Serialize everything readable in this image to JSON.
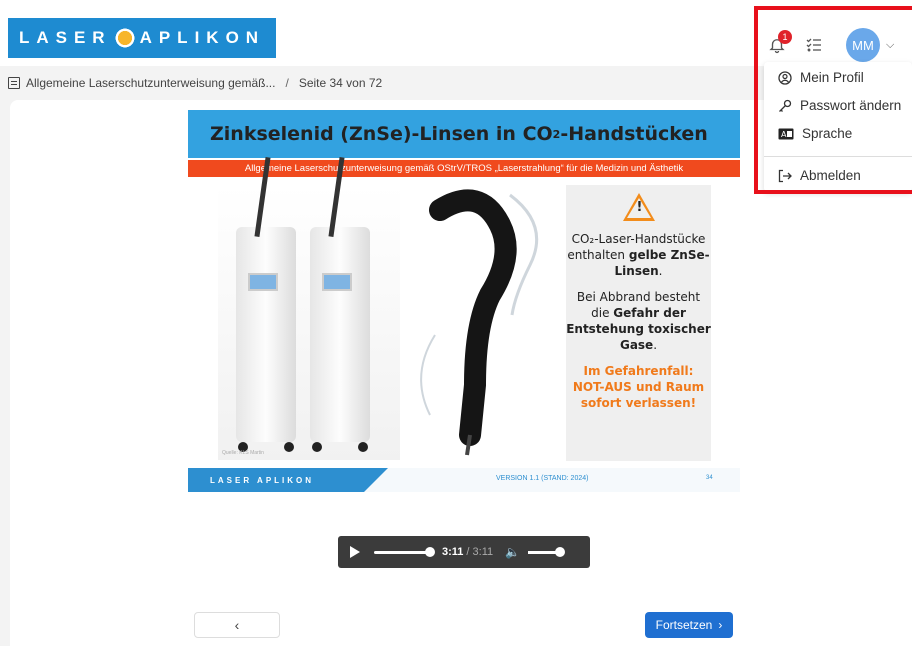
{
  "header": {
    "logo_left": "LASER",
    "logo_right": "APLIKON",
    "notification_count": "1",
    "avatar_initials": "MM"
  },
  "breadcrumb": {
    "course": "Allgemeine Laserschutzunterweisung gemäß...",
    "separator": "/",
    "page": "Seite 34 von 72"
  },
  "user_menu": {
    "items": [
      {
        "label": "Mein Profil",
        "icon": "user-circle-icon"
      },
      {
        "label": "Passwort ändern",
        "icon": "key-icon"
      },
      {
        "label": "Sprache",
        "icon": "language-icon"
      },
      {
        "label": "Abmelden",
        "icon": "logout-icon"
      }
    ]
  },
  "slide": {
    "title_pre": "Zinkselenid (ZnSe)-Linsen in CO",
    "title_sub": "2",
    "title_post": "-Handstücken",
    "subtitle": "Allgemeine Laserschutzunterweisung gemäß OStrV/TROS „Laserstrahlung“ für die Medizin und Ästhetik",
    "image_credit": "Quelle: KLS Martin",
    "info_line1": "CO₂-Laser-Handstücke enthalten ",
    "info_bold1": "gelbe ZnSe-Linsen",
    "info_line1_end": ".",
    "info_line2": "Bei Abbrand besteht die ",
    "info_bold2": "Gefahr der Entstehung toxischer Gase",
    "info_line2_end": ".",
    "info_warning": "Im Gefahrenfall: NOT-AUS und Raum sofort verlassen!",
    "footer_logo": "LASER APLIKON",
    "footer_version": "VERSION 1.1 (STAND: 2024)",
    "footer_page": "34"
  },
  "audio": {
    "current": "3:11",
    "total": "/ 3:11",
    "progress": 1.0
  },
  "nav": {
    "prev_label": "‹",
    "next_label": "Fortsetzen"
  },
  "colors": {
    "brand_blue": "#1e8bd1",
    "slide_title_bg": "#33a2e0",
    "subtitle_bg": "#f04a1e",
    "warning_orange": "#f07a1b",
    "next_button": "#1f6fd1",
    "highlight_red": "#e8101b"
  }
}
